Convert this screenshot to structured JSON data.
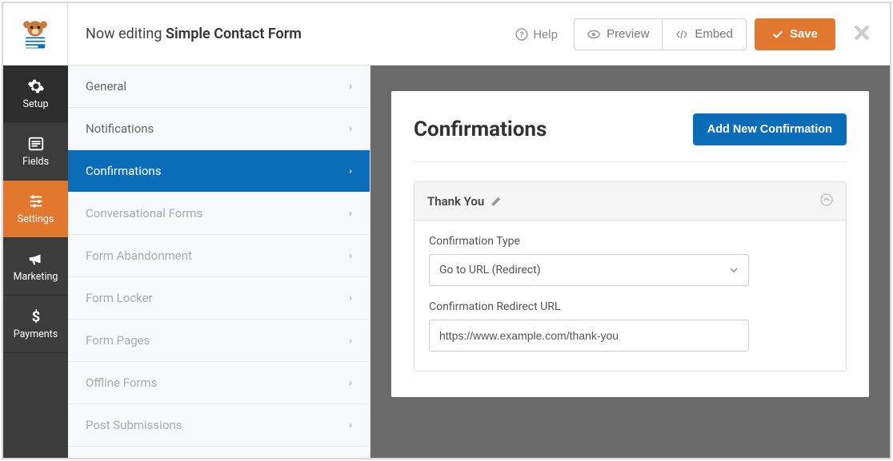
{
  "header": {
    "editing_prefix": "Now editing",
    "form_name": "Simple Contact Form",
    "help_label": "Help",
    "preview_label": "Preview",
    "embed_label": "Embed",
    "save_label": "Save"
  },
  "leftnav": {
    "items": [
      {
        "label": "Setup",
        "icon": "gear-icon"
      },
      {
        "label": "Fields",
        "icon": "list-icon"
      },
      {
        "label": "Settings",
        "icon": "sliders-icon"
      },
      {
        "label": "Marketing",
        "icon": "megaphone-icon"
      },
      {
        "label": "Payments",
        "icon": "dollar-icon"
      }
    ],
    "active_index": 2
  },
  "submenu": {
    "items": [
      {
        "label": "General",
        "disabled": false
      },
      {
        "label": "Notifications",
        "disabled": false
      },
      {
        "label": "Confirmations",
        "disabled": false
      },
      {
        "label": "Conversational Forms",
        "disabled": true
      },
      {
        "label": "Form Abandonment",
        "disabled": true
      },
      {
        "label": "Form Locker",
        "disabled": true
      },
      {
        "label": "Form Pages",
        "disabled": true
      },
      {
        "label": "Offline Forms",
        "disabled": true
      },
      {
        "label": "Post Submissions",
        "disabled": true
      }
    ],
    "active_index": 2
  },
  "content": {
    "title": "Confirmations",
    "add_button": "Add New Confirmation",
    "panel": {
      "name": "Thank You",
      "fields": {
        "type_label": "Confirmation Type",
        "type_value": "Go to URL (Redirect)",
        "url_label": "Confirmation Redirect URL",
        "url_value": "https://www.example.com/thank-you"
      }
    }
  }
}
